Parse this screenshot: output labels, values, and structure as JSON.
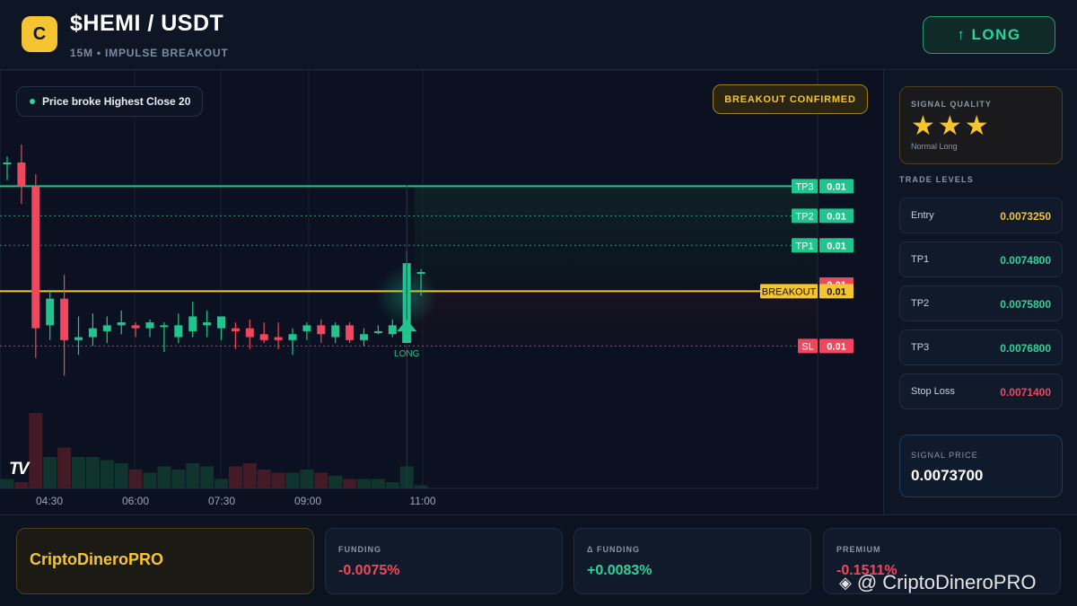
{
  "header": {
    "logo_letter": "C",
    "pair": "$HEMI / USDT",
    "subtitle": "15M • IMPULSE BREAKOUT",
    "signal_button": "↑ LONG"
  },
  "chart": {
    "status_pill": "Price broke Highest Close 20",
    "badge": "BREAKOUT CONFIRMED",
    "tv_logo": "TV",
    "long_marker_label": "LONG",
    "level_tags": [
      {
        "name": "TP3",
        "value": "0.01"
      },
      {
        "name": "TP2",
        "value": "0.01"
      },
      {
        "name": "TP1",
        "value": "0.01"
      },
      {
        "name": "",
        "value": "0.01"
      },
      {
        "name": "BREAKOUT",
        "value": "0.01"
      },
      {
        "name": "SL",
        "value": "0.01"
      }
    ],
    "time_labels": [
      "04:30",
      "06:00",
      "07:30",
      "09:00",
      "11:00"
    ]
  },
  "chart_data": {
    "type": "candlestick",
    "levels": {
      "tp3": 0.00768,
      "tp2": 0.00758,
      "tp1": 0.00748,
      "breakout": 0.007325,
      "stop_loss": 0.00714
    },
    "candles": [
      {
        "o": 0.00776,
        "h": 0.00778,
        "l": 0.0077,
        "c": 0.00776
      },
      {
        "o": 0.00776,
        "h": 0.00782,
        "l": 0.00762,
        "c": 0.00768
      },
      {
        "o": 0.00768,
        "h": 0.00772,
        "l": 0.0071,
        "c": 0.0072
      },
      {
        "o": 0.00721,
        "h": 0.00733,
        "l": 0.00716,
        "c": 0.0073
      },
      {
        "o": 0.0073,
        "h": 0.00738,
        "l": 0.00704,
        "c": 0.00716
      },
      {
        "o": 0.00716,
        "h": 0.00724,
        "l": 0.00711,
        "c": 0.00717
      },
      {
        "o": 0.00717,
        "h": 0.00725,
        "l": 0.00714,
        "c": 0.0072
      },
      {
        "o": 0.00719,
        "h": 0.00724,
        "l": 0.00715,
        "c": 0.00721
      },
      {
        "o": 0.00721,
        "h": 0.00726,
        "l": 0.00718,
        "c": 0.00722
      },
      {
        "o": 0.00721,
        "h": 0.00722,
        "l": 0.00717,
        "c": 0.0072
      },
      {
        "o": 0.0072,
        "h": 0.00723,
        "l": 0.00717,
        "c": 0.00722
      },
      {
        "o": 0.00721,
        "h": 0.00722,
        "l": 0.00712,
        "c": 0.00721
      },
      {
        "o": 0.00717,
        "h": 0.00725,
        "l": 0.00715,
        "c": 0.00721
      },
      {
        "o": 0.00719,
        "h": 0.00729,
        "l": 0.00717,
        "c": 0.00724
      },
      {
        "o": 0.00721,
        "h": 0.00726,
        "l": 0.00717,
        "c": 0.00722
      },
      {
        "o": 0.0072,
        "h": 0.00724,
        "l": 0.00716,
        "c": 0.00724
      },
      {
        "o": 0.0072,
        "h": 0.00722,
        "l": 0.00713,
        "c": 0.00719
      },
      {
        "o": 0.0072,
        "h": 0.00723,
        "l": 0.00713,
        "c": 0.00717
      },
      {
        "o": 0.00718,
        "h": 0.00722,
        "l": 0.00715,
        "c": 0.00716
      },
      {
        "o": 0.00717,
        "h": 0.00722,
        "l": 0.00713,
        "c": 0.00716
      },
      {
        "o": 0.00716,
        "h": 0.0072,
        "l": 0.00711,
        "c": 0.00718
      },
      {
        "o": 0.00719,
        "h": 0.00722,
        "l": 0.00716,
        "c": 0.00721
      },
      {
        "o": 0.00721,
        "h": 0.00723,
        "l": 0.00715,
        "c": 0.00718
      },
      {
        "o": 0.00717,
        "h": 0.00722,
        "l": 0.00715,
        "c": 0.00721
      },
      {
        "o": 0.00721,
        "h": 0.00722,
        "l": 0.00715,
        "c": 0.00716
      },
      {
        "o": 0.00716,
        "h": 0.0072,
        "l": 0.00714,
        "c": 0.00718
      },
      {
        "o": 0.00719,
        "h": 0.00721,
        "l": 0.00718,
        "c": 0.00719
      },
      {
        "o": 0.00718,
        "h": 0.00723,
        "l": 0.00717,
        "c": 0.00721
      },
      {
        "o": 0.00721,
        "h": 0.00746,
        "l": 0.0072,
        "c": 0.00742
      },
      {
        "o": 0.00739,
        "h": 0.0074,
        "l": 0.00731,
        "c": 0.00739
      }
    ],
    "volume": [
      3,
      2,
      24,
      10,
      13,
      10,
      10,
      9,
      8,
      6,
      5,
      7,
      6,
      8,
      7,
      3,
      7,
      8,
      6,
      5,
      5,
      6,
      5,
      4,
      3,
      3,
      3,
      2,
      7,
      1
    ]
  },
  "panel": {
    "quality_label": "SIGNAL QUALITY",
    "stars": "★★★",
    "quality_type": "Normal Long",
    "levels_title": "TRADE LEVELS",
    "levels": [
      {
        "label": "Entry",
        "value": "0.0073250",
        "color": "#f5c531"
      },
      {
        "label": "TP1",
        "value": "0.0074800",
        "color": "#2fd39a"
      },
      {
        "label": "TP2",
        "value": "0.0075800",
        "color": "#2fd39a"
      },
      {
        "label": "TP3",
        "value": "0.0076800",
        "color": "#2fd39a"
      },
      {
        "label": "Stop Loss",
        "value": "0.0071400",
        "color": "#f0475e"
      }
    ],
    "signal_price_label": "SIGNAL PRICE",
    "signal_price": "0.0073700"
  },
  "footer": {
    "brand": "CriptoDineroPRO",
    "stats": [
      {
        "label": "FUNDING",
        "value": "-0.0075%",
        "color": "#f0475e"
      },
      {
        "label": "Δ FUNDING",
        "value": "+0.0083%",
        "color": "#2fd39a"
      },
      {
        "label": "PREMIUM",
        "value": "-0.1511%",
        "color": "#f0475e"
      }
    ],
    "watermark": "@ CriptoDineroPRO"
  },
  "colors": {
    "up": "#22c38e",
    "down": "#f0475e",
    "accent": "#f5c531"
  }
}
